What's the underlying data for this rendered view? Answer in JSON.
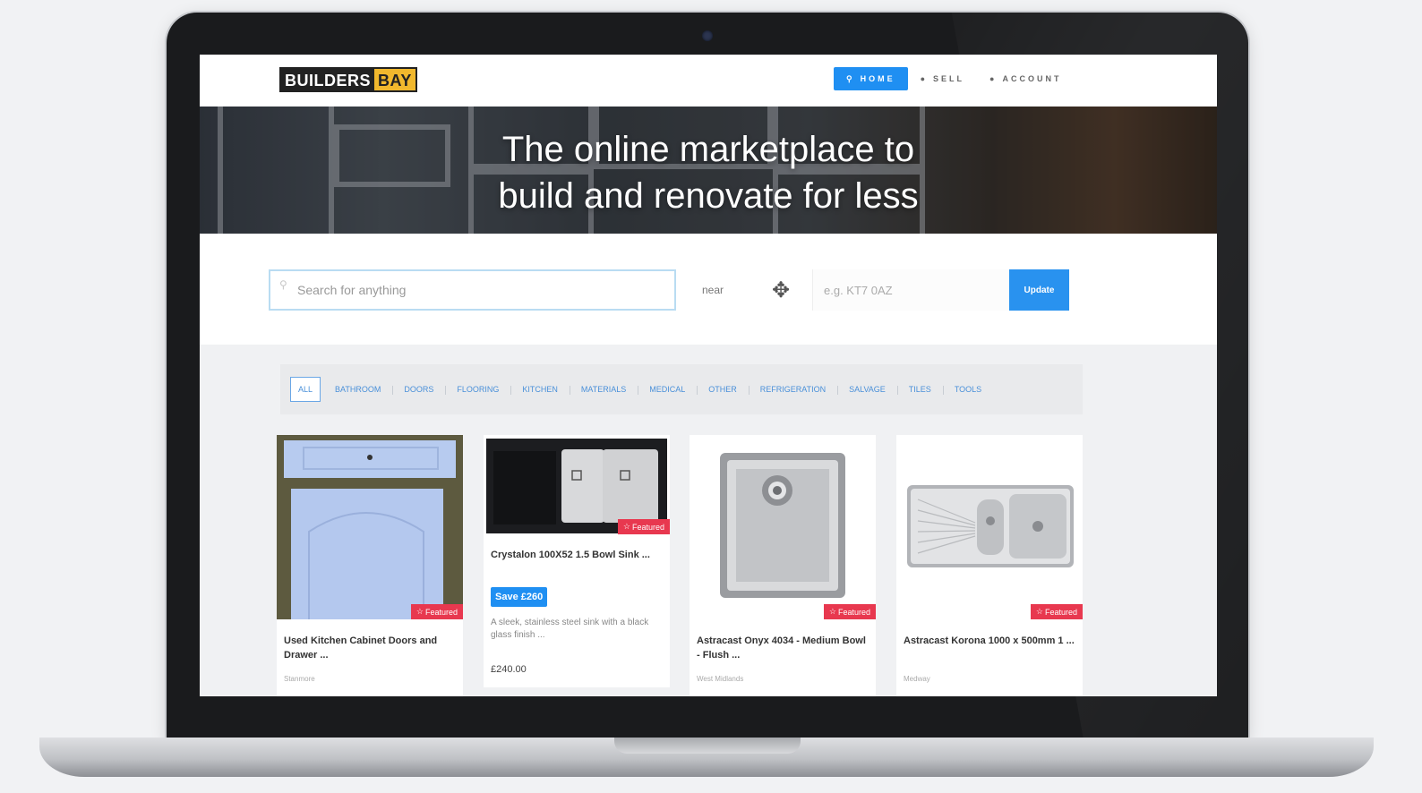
{
  "brand": {
    "logo_part1": "BUILDERS",
    "logo_part2": "BAY",
    "accent_color": "#f1b82d"
  },
  "nav": {
    "home": "HOME",
    "sell": "SELL",
    "account": "ACCOUNT",
    "active_color": "#1f8ff2"
  },
  "hero": {
    "line1": "The online marketplace to",
    "line2": "build and renovate for less"
  },
  "search": {
    "placeholder": "Search for anything",
    "near_label": "near",
    "postcode_placeholder": "e.g. KT7 0AZ",
    "update_label": "Update"
  },
  "categories": [
    "ALL",
    "BATHROOM",
    "DOORS",
    "FLOORING",
    "KITCHEN",
    "MATERIALS",
    "MEDICAL",
    "OTHER",
    "REFRIGERATION",
    "SALVAGE",
    "TILES",
    "TOOLS"
  ],
  "listings": [
    {
      "title": "Used Kitchen Cabinet Doors and Drawer ...",
      "badge": "Featured",
      "location": "Stanmore"
    },
    {
      "title": "Crystalon 100X52 1.5 Bowl Sink ...",
      "badge": "Featured",
      "save": "Save £260",
      "description": "A sleek, stainless steel sink with a black glass finish ...",
      "price": "£240.00"
    },
    {
      "title": "Astracast Onyx 4034 - Medium Bowl - Flush ...",
      "badge": "Featured",
      "location": "West Midlands"
    },
    {
      "title": "Astracast Korona 1000 x 500mm 1 ...",
      "badge": "Featured",
      "location": "Medway"
    }
  ]
}
